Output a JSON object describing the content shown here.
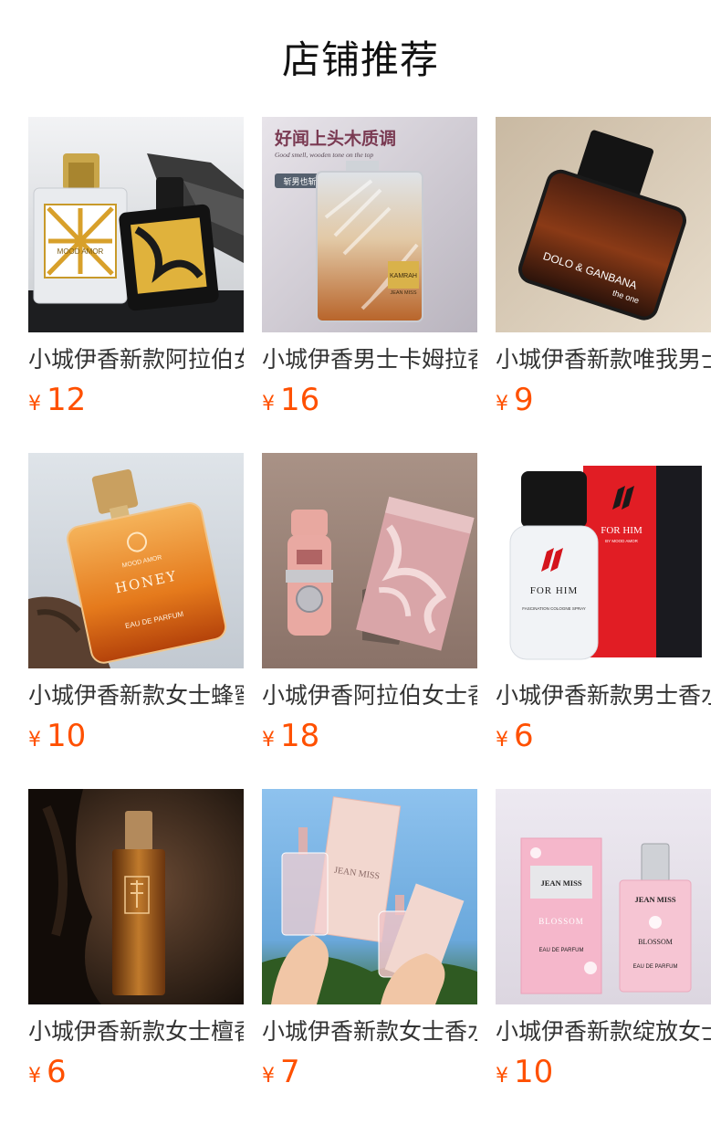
{
  "section": {
    "title": "店铺推荐"
  },
  "currency": "¥",
  "products": [
    {
      "name": "小城伊香新款阿拉伯女士香水",
      "price": "12",
      "image_text": [
        "MOOD AMOR"
      ]
    },
    {
      "name": "小城伊香男士卡姆拉香水",
      "price": "16",
      "image_text": [
        "好闻上头木质调",
        "Good smell, wooden tone on the top",
        "斩男也斩女",
        "KAMRAH",
        "JEAN MISS"
      ]
    },
    {
      "name": "小城伊香新款唯我男士香水",
      "price": "9",
      "image_text": [
        "DOLO & GANBANA",
        "the one"
      ]
    },
    {
      "name": "小城伊香新款女士蜂蜜香水",
      "price": "10",
      "image_text": [
        "MOOD AMOR",
        "HONEY",
        "EAU DE PARFUM"
      ]
    },
    {
      "name": "小城伊香阿拉伯女士香水",
      "price": "18",
      "image_text": []
    },
    {
      "name": "小城伊香新款男士香水",
      "price": "6",
      "image_text": [
        "FOR HIM",
        "BY MOOD AMOR",
        "FASCINATION COLOGNE SPRAY",
        "FOR HIM"
      ]
    },
    {
      "name": "小城伊香新款女士檀香香水",
      "price": "6",
      "image_text": []
    },
    {
      "name": "小城伊香新款女士香水",
      "price": "7",
      "image_text": [
        "JEAN MISS"
      ]
    },
    {
      "name": "小城伊香新款绽放女士香水",
      "price": "10",
      "image_text": [
        "JEAN MISS",
        "BLOSSOM",
        "EAU DE PARFUM",
        "JEAN MISS",
        "BLOSSOM",
        "EAU DE PARFUM"
      ]
    }
  ],
  "colors": {
    "price": "#ff5000",
    "title": "#111111",
    "name": "#333333"
  }
}
